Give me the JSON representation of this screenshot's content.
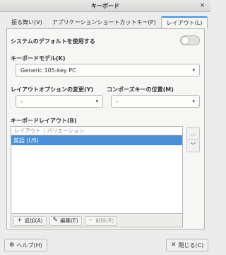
{
  "window": {
    "title": "キーボード",
    "close_glyph": "×"
  },
  "tabs": [
    {
      "label": "振る舞い(V)",
      "active": false
    },
    {
      "label": "アプリケーションショートカットキー(P)",
      "active": false
    },
    {
      "label": "レイアウト(L)",
      "active": true
    }
  ],
  "system_default": {
    "label": "システムのデフォルトを使用する",
    "enabled": false
  },
  "keyboard_model": {
    "label": "キーボードモデル(K)",
    "value": "Generic 105-key PC"
  },
  "layout_option": {
    "label": "レイアウトオプションの変更(Y)",
    "value": "-"
  },
  "compose_key": {
    "label": "コンポーズキーの位置(M)",
    "value": "-"
  },
  "keyboard_layout": {
    "label": "キーボードレイアウト(B)",
    "columns": [
      "レイアウト",
      "バリエーション"
    ],
    "rows": [
      {
        "layout": "英語 (US)",
        "variation": ""
      }
    ]
  },
  "list_toolbar": {
    "add": "追加(A)",
    "edit": "編集(E)",
    "remove": "削除(R)"
  },
  "footer": {
    "help": "ヘルプ(H)",
    "close": "閉じる(C)"
  },
  "icons": {
    "up": "chevron-up-icon",
    "down": "chevron-down-icon",
    "add": "plus-icon",
    "edit": "pencil-icon",
    "remove": "minus-icon",
    "help": "lifebuoy-icon",
    "close": "close-icon"
  },
  "colors": {
    "accent": "#4a90d9",
    "background": "#ececec",
    "panel": "#f6f6f5"
  }
}
